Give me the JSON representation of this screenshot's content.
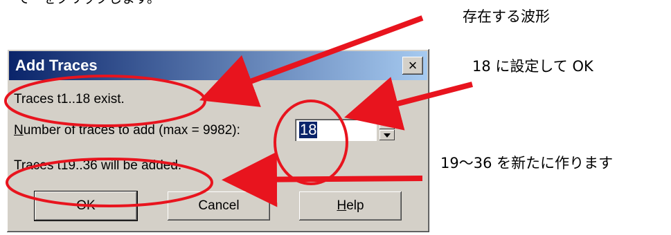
{
  "top_fragment": "でーをクリックします。",
  "dialog": {
    "title": "Add Traces",
    "close_symbol": "×",
    "exist_text": "Traces t1..18 exist.",
    "number_label_prefix": "N",
    "number_label_rest": "umber of traces to add (max = 9982):",
    "number_value": "18",
    "added_text": "Traces t19..36 will be added.",
    "buttons": {
      "ok": "OK",
      "cancel": "Cancel",
      "help_prefix": "H",
      "help_rest": "elp"
    }
  },
  "annotations": {
    "existing_waveform": "存在する波形",
    "set_to_18": "18 に設定して OK",
    "create_new": "19〜36 を新たに作ります"
  },
  "colors": {
    "callout": "#e8141e",
    "titlebar": "#0a246a",
    "dialog_bg": "#d4d0c8"
  }
}
